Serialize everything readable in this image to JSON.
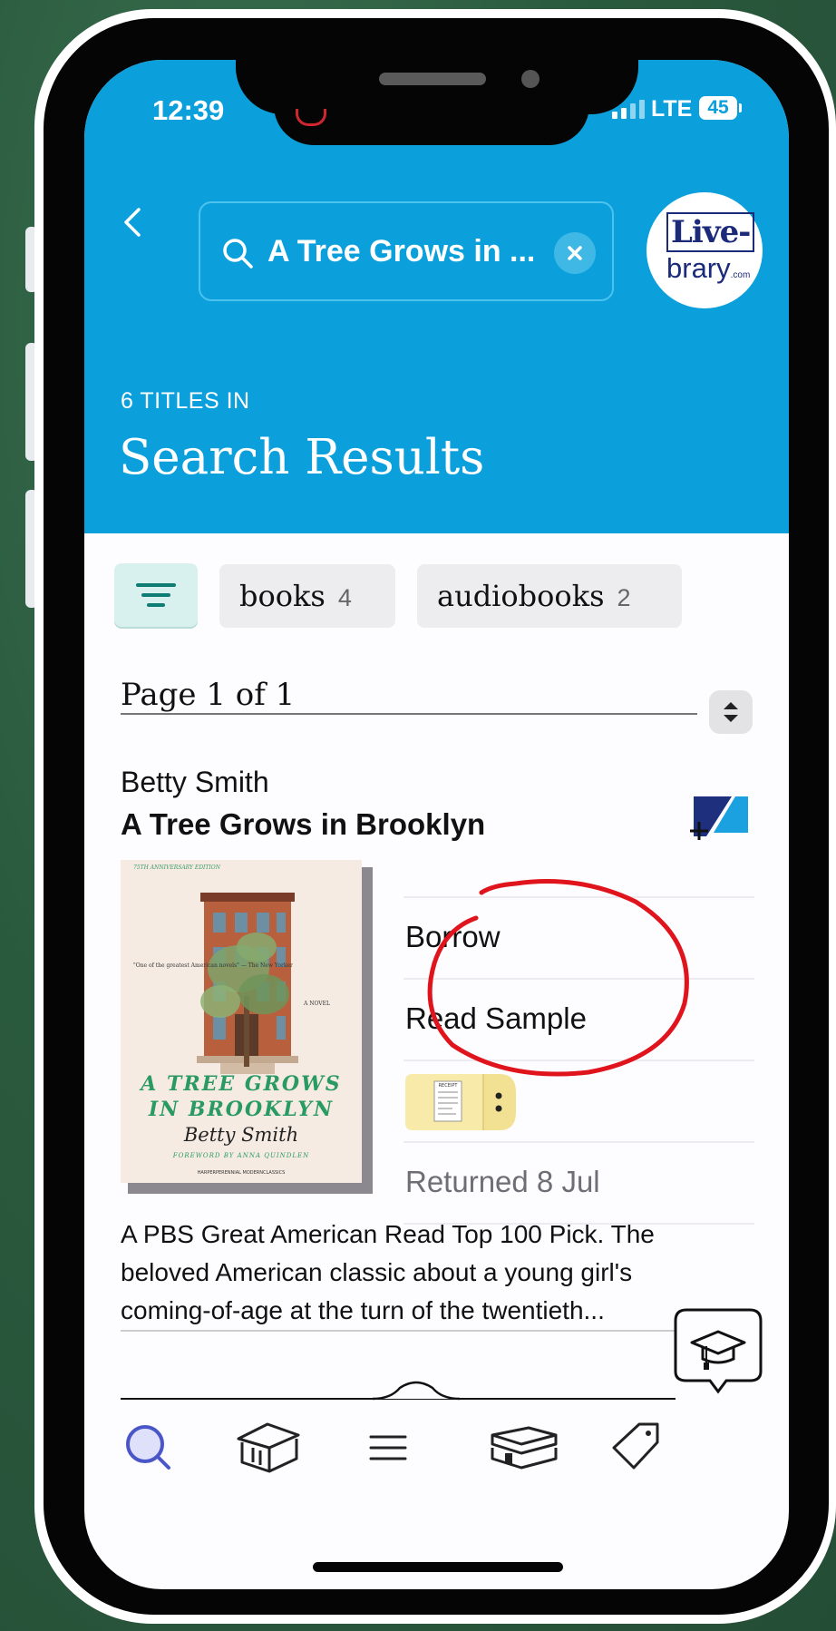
{
  "status_bar": {
    "time": "12:39",
    "network": "LTE",
    "battery": "45"
  },
  "header": {
    "search_query": "A Tree Grows in ...",
    "logo_top": "Live-",
    "logo_bottom": "brary",
    "logo_suffix": ".com",
    "titles_count": "6 TITLES IN",
    "title": "Search Results"
  },
  "filters": [
    {
      "label": "books",
      "count": "4"
    },
    {
      "label": "audiobooks",
      "count": "2"
    }
  ],
  "pagination": {
    "label": "Page 1 of 1"
  },
  "result": {
    "author": "Betty Smith",
    "title": "A Tree Grows in Brooklyn",
    "cover": {
      "edition": "75TH ANNIVERSARY EDITION",
      "quote": "\"One of the greatest American novels\" — The New Yorker",
      "novel": "A NOVEL",
      "title_line1": "A TREE GROWS",
      "title_line2": "IN BROOKLYN",
      "author": "Betty Smith",
      "foreword": "FOREWORD BY ANNA QUINDLEN",
      "publisher": "HARPERPERENNIAL MODERNCLASSICS"
    },
    "actions": {
      "borrow": "Borrow",
      "read_sample": "Read Sample",
      "receipt_label": "RECEIPT",
      "returned": "Returned 8 Jul"
    },
    "description": "A PBS Great American Read Top 100 Pick. The beloved American classic about a young girl's coming-of-age at the turn of the twentieth..."
  },
  "tabs": [
    "search-icon",
    "library-icon",
    "menu-icon",
    "shelf-icon",
    "tag-icon"
  ],
  "colors": {
    "header": "#0ba0dc",
    "accent": "#4a56c8",
    "annotation": "#e0141c"
  }
}
